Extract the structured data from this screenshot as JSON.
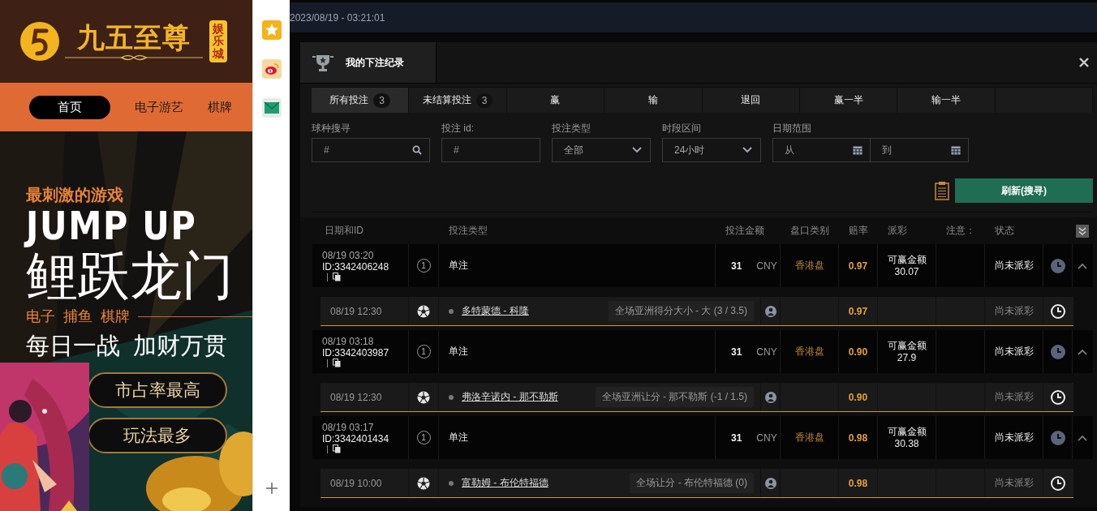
{
  "site": {
    "logo_text": "九五至尊",
    "logo_badge": "娱乐城",
    "nav": [
      {
        "label": "首页",
        "selected": true
      },
      {
        "label": "电子游艺",
        "selected": false
      },
      {
        "label": "棋牌",
        "selected": false
      }
    ],
    "banner": {
      "kicker": "最刺激的游戏",
      "headline": "JUMP UP",
      "title": "鲤跃龙门",
      "categories": [
        "电子",
        "捕鱼",
        "棋牌"
      ],
      "slogan": [
        "每日一战",
        "加财万贯"
      ],
      "highlights": [
        "市占率最高",
        "玩法最多"
      ]
    }
  },
  "app": {
    "clock": "2023/08/19 - 03:21:01",
    "modal": {
      "title": "我的下注纪录",
      "tabs": [
        {
          "label": "所有投注",
          "count": "3",
          "selected": true
        },
        {
          "label": "未结算投注",
          "count": "3",
          "selected": false
        },
        {
          "label": "赢",
          "selected": false
        },
        {
          "label": "输",
          "selected": false
        },
        {
          "label": "退回",
          "selected": false
        },
        {
          "label": "赢一半",
          "selected": false
        },
        {
          "label": "输一半",
          "selected": false
        }
      ],
      "filters": [
        {
          "kind": "search",
          "label": "球种搜寻",
          "placeholder": "#"
        },
        {
          "kind": "text",
          "label": "投注 id:",
          "placeholder": "#"
        },
        {
          "kind": "select",
          "label": "投注类型",
          "value": "全部"
        },
        {
          "kind": "select",
          "label": "时段区间",
          "value": "24小时"
        },
        {
          "kind": "daterange",
          "label": "日期范围",
          "from_placeholder": "从",
          "to_placeholder": "到"
        }
      ],
      "refresh_button": "刷新(搜寻)",
      "columns": [
        "日期和ID",
        "投注类型",
        "投注金额",
        "盘口类别",
        "赔率",
        "派彩",
        "注意：",
        "状态"
      ],
      "bets": [
        {
          "time": "08/19 03:20",
          "id": "ID:3342406248",
          "legs": "1",
          "bet_type": "单注",
          "amount": "31",
          "currency": "CNY",
          "market": "香港盘",
          "odds": "0.97",
          "payout_label": "可赢金额",
          "payout": "30.07",
          "status": "尚未派彩",
          "expanded": true,
          "selections": [
            {
              "time": "08/19 12:30",
              "match": "多特蒙德 - 科隆",
              "line": "全场亚洲得分大小 - 大 (3 / 3.5)",
              "odds": "0.97",
              "status": "尚未派彩"
            }
          ]
        },
        {
          "time": "08/19 03:18",
          "id": "ID:3342403987",
          "legs": "1",
          "bet_type": "单注",
          "amount": "31",
          "currency": "CNY",
          "market": "香港盘",
          "odds": "0.90",
          "payout_label": "可赢金额",
          "payout": "27.9",
          "status": "尚未派彩",
          "expanded": true,
          "selections": [
            {
              "time": "08/19 12:30",
              "match": "弗洛辛诺内 - 那不勒斯",
              "line": "全场亚洲让分 - 那不勒斯 (-1 / 1.5)",
              "odds": "0.90",
              "status": "尚未派彩"
            }
          ]
        },
        {
          "time": "08/19 03:17",
          "id": "ID:3342401434",
          "legs": "1",
          "bet_type": "单注",
          "amount": "31",
          "currency": "CNY",
          "market": "香港盘",
          "odds": "0.98",
          "payout_label": "可赢金额",
          "payout": "30.38",
          "status": "尚未派彩",
          "expanded": true,
          "selections": [
            {
              "time": "08/19 10:00",
              "match": "富勒姆 - 布伦特福德",
              "line": "全场让分 - 布伦特福德 (0)",
              "odds": "0.98",
              "status": "尚未派彩"
            }
          ]
        }
      ]
    }
  }
}
